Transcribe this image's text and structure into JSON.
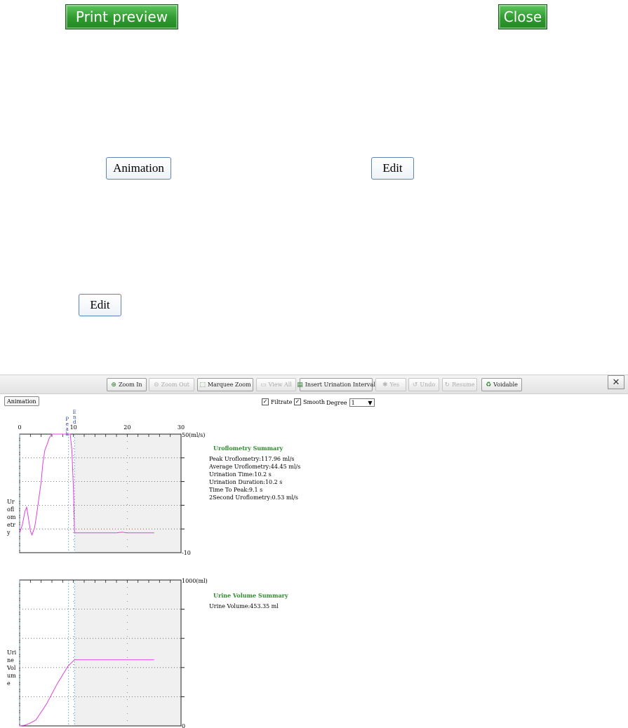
{
  "top": {
    "print_preview": "Print preview",
    "close": "Close",
    "animation": "Animation",
    "edit1": "Edit",
    "edit2": "Edit"
  },
  "toolbar": [
    {
      "label": "Zoom In",
      "icon": "zoom-in-icon",
      "glyph": "⊕",
      "enabled": true
    },
    {
      "label": "Zoom Out",
      "icon": "zoom-out-icon",
      "glyph": "⊖",
      "enabled": false
    },
    {
      "label": "Marquee Zoom",
      "icon": "marquee-zoom-icon",
      "glyph": "⬚",
      "enabled": true
    },
    {
      "label": "View All",
      "icon": "view-all-icon",
      "glyph": "▭",
      "enabled": false
    },
    {
      "label": "Insert Urination Interval",
      "icon": "insert-interval-icon",
      "glyph": "▤",
      "enabled": true
    },
    {
      "label": "Yes",
      "icon": "yes-icon",
      "glyph": "✱",
      "enabled": false
    },
    {
      "label": "Undo",
      "icon": "undo-icon",
      "glyph": "↺",
      "enabled": false
    },
    {
      "label": "Resume",
      "icon": "resume-icon",
      "glyph": "↻",
      "enabled": false
    },
    {
      "label": "Voidable",
      "icon": "voidable-icon",
      "glyph": "♻",
      "enabled": true
    }
  ],
  "panel": {
    "close_glyph": "✕",
    "animation": "Animation",
    "filtrate": "Filtrate",
    "smooth": "Smooth",
    "degree_label": "Degree",
    "degree_value": "1",
    "check": "✓",
    "dropdown": "▼"
  },
  "markers": {
    "peak": "Peak",
    "end": "End"
  },
  "uroflow_summary": {
    "title": "Uroflometry Summary",
    "lines": [
      "Peak Uroflometry:117.96 ml/s",
      "Average Uroflometry:44.45 ml/s",
      "Urination Time:10.2 s",
      "Urination Duration:10.2 s",
      "Time To Peak:9.1 s",
      "2Second Uroflometry:0.53 ml/s"
    ]
  },
  "volume_summary": {
    "title": "Urine Volume Summary",
    "lines": [
      "Urine Volume:453.35 ml"
    ]
  },
  "chart_data": [
    {
      "type": "line",
      "ylabel": "Uroflometry",
      "x_ticks": [
        "0",
        "10",
        "20",
        "30"
      ],
      "xlim": [
        0,
        30
      ],
      "y_top_label": "50(ml/s)",
      "y_bottom_label": "-10",
      "ylim": [
        -10,
        50
      ],
      "color": "#e040e0",
      "x": [
        0,
        0.5,
        1,
        1.3,
        1.6,
        2.0,
        2.3,
        2.8,
        3.2,
        3.6,
        4.0,
        4.3,
        4.7,
        5.0,
        5.5,
        6.0,
        6.5,
        7.0,
        7.5,
        8.0,
        8.5,
        9.1,
        9.4,
        9.7,
        10.0,
        10.2,
        12,
        15,
        18,
        19,
        20,
        22,
        25
      ],
      "y": [
        0,
        4,
        11,
        13,
        8,
        1,
        -1,
        3,
        10,
        18,
        26,
        35,
        42,
        44,
        48,
        50,
        50,
        50,
        50,
        50,
        50,
        50,
        50,
        42,
        22,
        0,
        0,
        0,
        0,
        0.4,
        0,
        0,
        0
      ]
    },
    {
      "type": "line",
      "ylabel": "Urine Volume",
      "xlim": [
        0,
        30
      ],
      "y_top_label": "1000(ml)",
      "y_bottom_label": "0",
      "ylim": [
        0,
        1000
      ],
      "color": "#e040e0",
      "x": [
        0,
        1,
        2,
        3,
        4,
        5,
        6,
        7,
        8,
        9,
        10.2,
        12,
        16,
        20,
        25
      ],
      "y": [
        0,
        5,
        20,
        40,
        95,
        150,
        220,
        290,
        350,
        410,
        453,
        453,
        453,
        453,
        453
      ]
    }
  ]
}
